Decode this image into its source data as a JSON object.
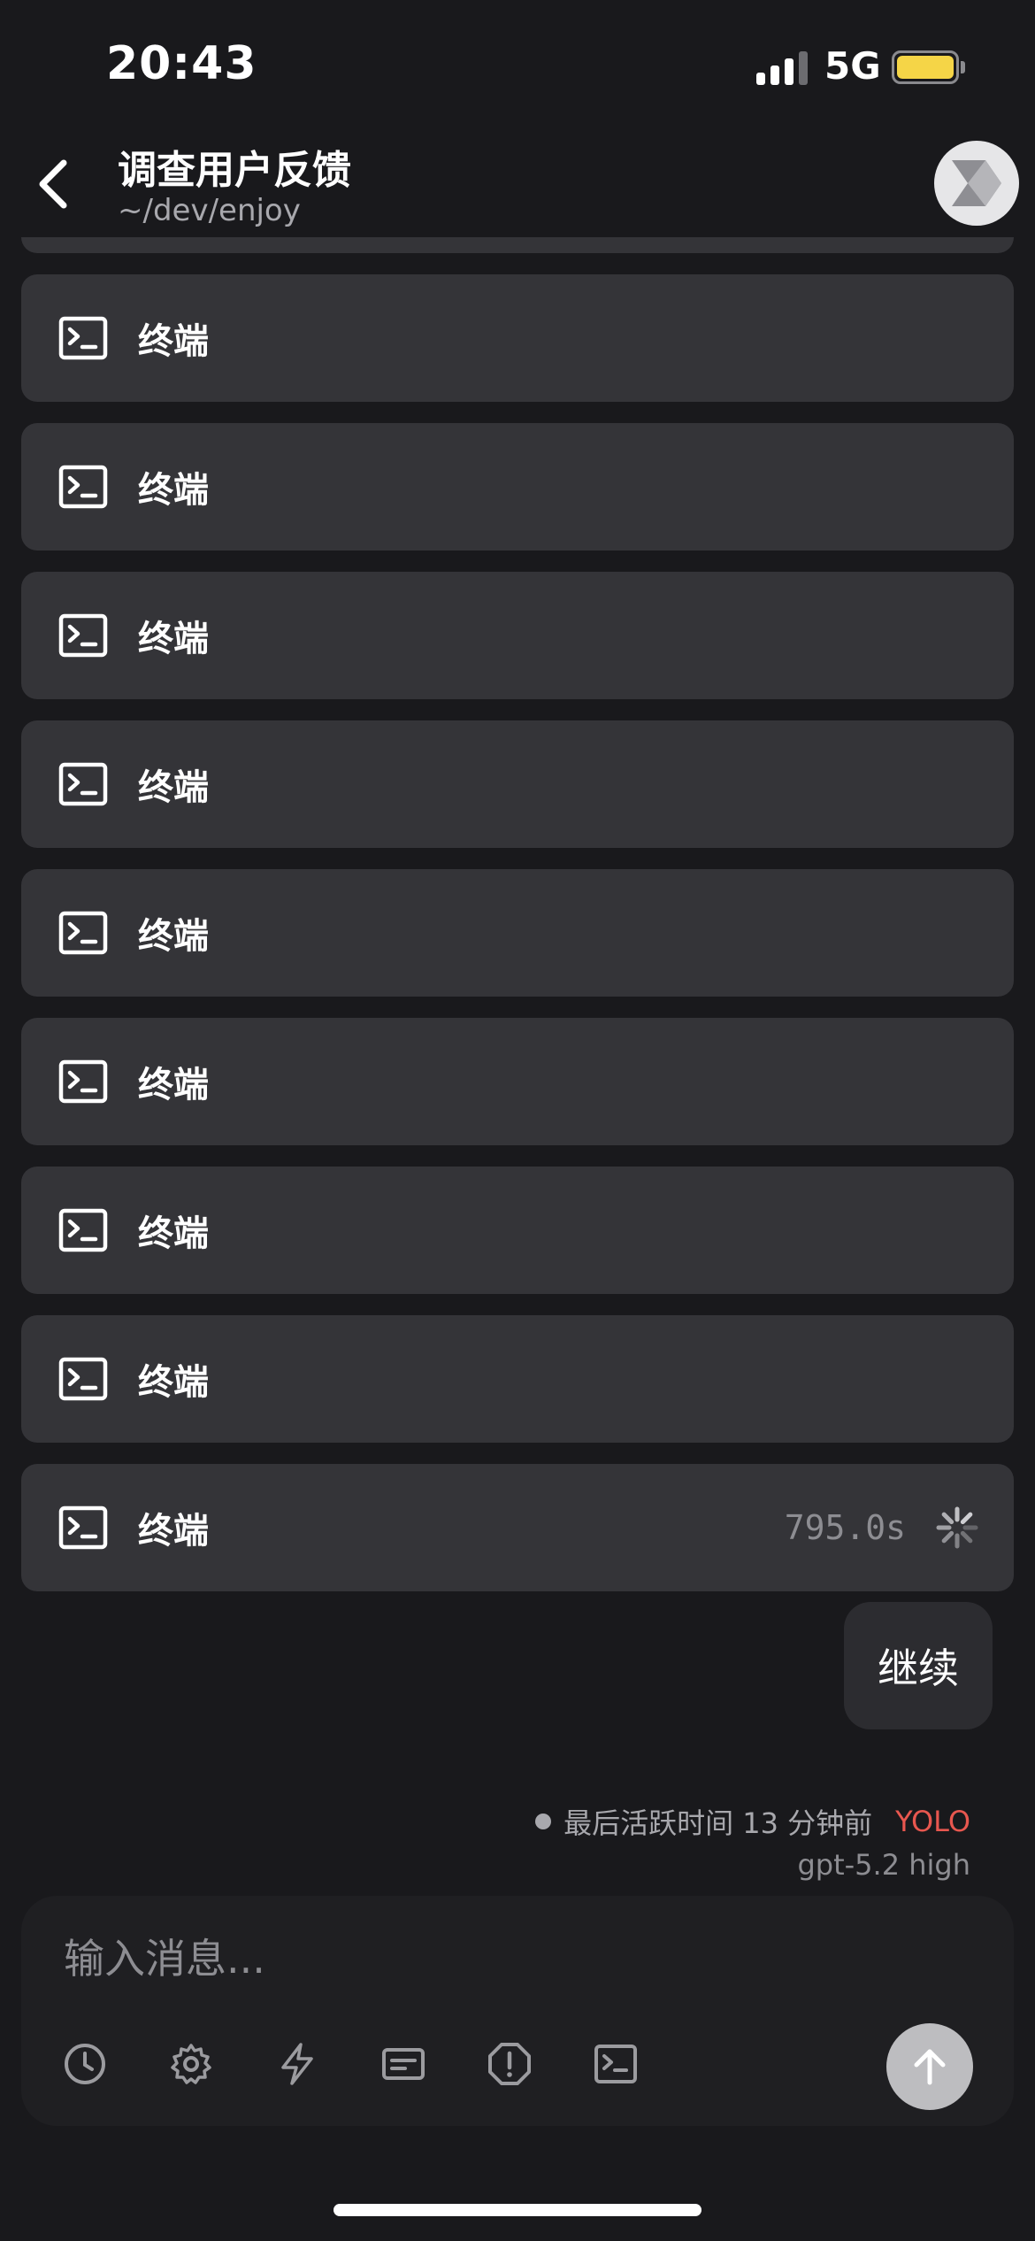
{
  "status_bar": {
    "time": "20:43",
    "network": "5G"
  },
  "header": {
    "title": "调查用户反馈",
    "subtitle": "~/dev/enjoy"
  },
  "terminal_cards": [
    {
      "label": "终端"
    },
    {
      "label": "终端"
    },
    {
      "label": "终端"
    },
    {
      "label": "终端"
    },
    {
      "label": "终端"
    },
    {
      "label": "终端"
    },
    {
      "label": "终端"
    },
    {
      "label": "终端"
    },
    {
      "label": "终端",
      "elapsed": "795.0s"
    }
  ],
  "message_bubble": {
    "text": "继续"
  },
  "activity": {
    "last_active": "最后活跃时间 13 分钟前",
    "mode": "YOLO",
    "model": "gpt-5.2 high"
  },
  "composer": {
    "placeholder": "输入消息..."
  },
  "icons": {
    "back": "chevron-left-icon",
    "avatar": "app-logo-icon",
    "terminal": "terminal-icon",
    "spinner": "loading-spinner-icon",
    "tools": [
      "clock-icon",
      "gear-icon",
      "lightning-icon",
      "message-box-icon",
      "alert-octagon-icon",
      "terminal-icon"
    ],
    "send": "arrow-up-icon"
  },
  "colors": {
    "background": "#19191c",
    "card": "#343438",
    "yolo": "#e8574f",
    "battery": "#f5d547"
  }
}
